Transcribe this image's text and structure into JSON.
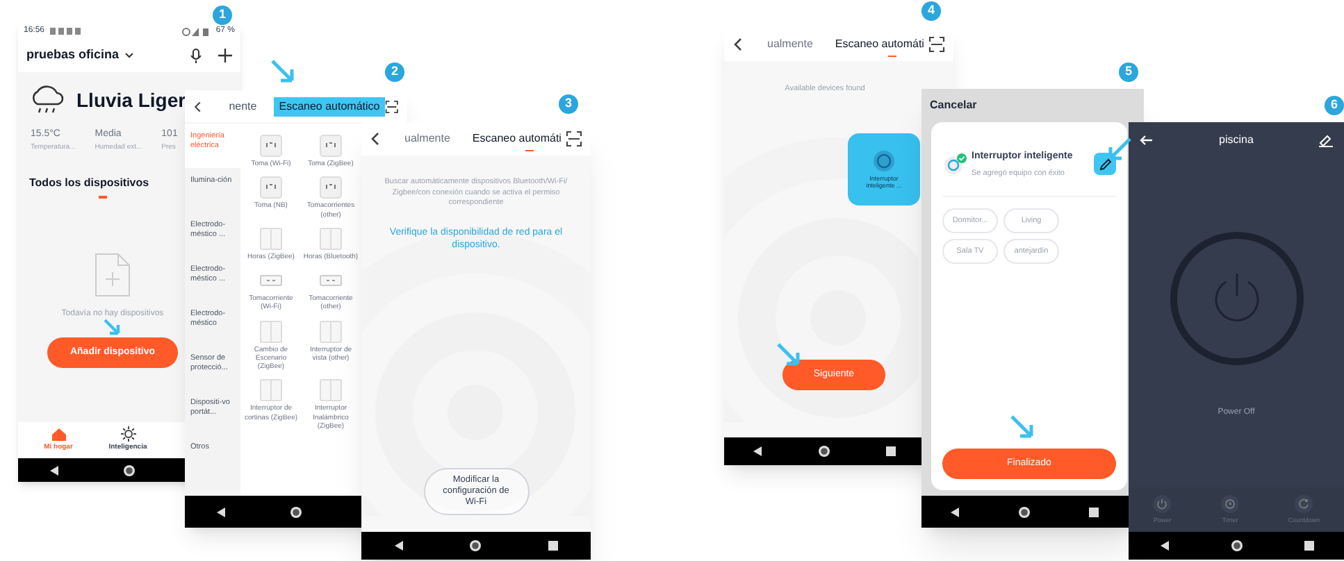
{
  "step_1": {
    "badge": "1",
    "status_bar": {
      "time": "16:56",
      "battery": "67 %"
    },
    "home_name": "pruebas oficina",
    "weather": {
      "condition": "Lluvia Liger",
      "stats": [
        {
          "value": "15.5°C",
          "label": "Temperatura..."
        },
        {
          "value": "Media",
          "label": "Humedad ext..."
        },
        {
          "value": "101",
          "label": "Pres"
        }
      ]
    },
    "section": "Todos los dispositivos",
    "empty_message": "Todavía no hay dispositivos",
    "add_button": "Añadir dispositivo",
    "bottom_nav": [
      {
        "label": "Mi hogar",
        "selected": true,
        "kind": "home"
      },
      {
        "label": "Inteligencia",
        "selected": false,
        "kind": "sun"
      }
    ]
  },
  "step_2": {
    "badge": "2",
    "tabs": [
      {
        "label": "nente",
        "selected": false,
        "highlighted": false
      },
      {
        "label": "Escaneo automático",
        "selected": true,
        "highlighted": true
      }
    ],
    "categories": [
      {
        "label": "Ingeniería eléctrica",
        "selected": true
      },
      {
        "label": "Ilumina-ción",
        "selected": false
      },
      {
        "label": "Electrodo-méstico ...",
        "selected": false
      },
      {
        "label": "Electrodo-méstico ...",
        "selected": false
      },
      {
        "label": "Electrodo-méstico",
        "selected": false
      },
      {
        "label": "Sensor de protecció...",
        "selected": false
      },
      {
        "label": "Dispositi-vo portát...",
        "selected": false
      },
      {
        "label": "Otros",
        "selected": false
      }
    ],
    "devices": [
      {
        "label": "Toma (Wi-Fi)",
        "kind": "socket"
      },
      {
        "label": "Toma (ZigBee)",
        "kind": "socket"
      },
      {
        "label": "Toma (NB)",
        "kind": "socket"
      },
      {
        "label": "Tomacorrientes (other)",
        "kind": "socket"
      },
      {
        "label": "Horas (ZigBee)",
        "kind": "switch"
      },
      {
        "label": "Horas (Bluetooth)",
        "kind": "switch"
      },
      {
        "label": "Tomacorriente (Wi-Fi)",
        "kind": "strip"
      },
      {
        "label": "Tomacorriente (other)",
        "kind": "strip"
      },
      {
        "label": "Cambio de Escenario (ZigBee)",
        "kind": "switch"
      },
      {
        "label": "Interruptor de vista (other)",
        "kind": "switch"
      },
      {
        "label": "Interruptor de cortinas (ZigBee)",
        "kind": "switch"
      },
      {
        "label": "Interruptor Inalámbrico (ZigBee)",
        "kind": "switch"
      }
    ]
  },
  "step_3": {
    "badge": "3",
    "tabs": [
      {
        "label": "ualmente",
        "selected": false
      },
      {
        "label": "Escaneo automáti",
        "selected": true
      }
    ],
    "description": "Buscar automáticamente dispositivos Bluetooth/Wi-Fi/ Zigbee/con conexión cuando se activa el permiso correspondiente",
    "network_hint": "Verifique la disponibilidad de red para el dispositivo.",
    "wifi_button": "Modificar la configuración de Wi-Fi"
  },
  "step_4": {
    "badge": "4",
    "tabs": [
      {
        "label": "ualmente",
        "selected": false
      },
      {
        "label": "Escaneo automáti",
        "selected": true
      }
    ],
    "status": "Available devices found",
    "found_device": "Interruptor inteligente ...",
    "next_button": "Siguiente"
  },
  "step_5": {
    "badge": "5",
    "cancel": "Cancelar",
    "device_name": "Interruptor inteligente",
    "success_message": "Se agregó equipo con éxito",
    "rooms": [
      "Dormitor...",
      "Living",
      "Sala TV",
      "antejardín"
    ],
    "done_button": "Finalizado"
  },
  "step_6": {
    "badge": "6",
    "title": "piscina",
    "power_state": "Power Off",
    "controls": [
      {
        "label": "Power",
        "kind": "power"
      },
      {
        "label": "Timer",
        "kind": "timer"
      },
      {
        "label": "Countdown",
        "kind": "countdown"
      }
    ]
  }
}
